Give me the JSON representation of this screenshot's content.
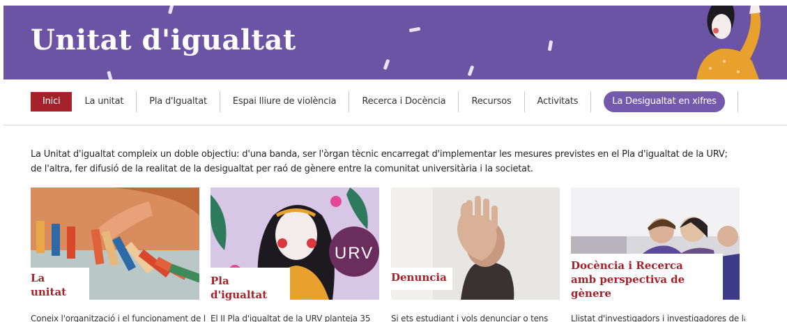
{
  "banner": {
    "title": "Unitat d'igualtat"
  },
  "nav": {
    "items": [
      {
        "label": "Inici",
        "active": true
      },
      {
        "label": "La unitat"
      },
      {
        "label": "Pla d'Igualtat"
      },
      {
        "label": "Espai lliure de violència"
      },
      {
        "label": "Recerca i Docència"
      },
      {
        "label": "Recursos"
      },
      {
        "label": "Activitats"
      }
    ],
    "highlight": "La Desigualtat en xifres"
  },
  "intro": "La Unitat d'igualtat compleix un doble objectiu: d'una banda, ser l'òrgan tècnic encarregat d'implementar les mesures previstes en el Pla d'igualtat de la URV; de l'altra, fer difusió de la realitat de la desigualtat per raó de gènere entre la comunitat universitària i la societat.",
  "cards": [
    {
      "title": "La unitat",
      "desc": "Coneix l'organització i el funcionament de la"
    },
    {
      "title": "Pla d'igualtat",
      "desc": "El II Pla d'igualtat de la URV planteja 35"
    },
    {
      "title": "Denuncia",
      "desc": "Si ets estudiant i vols denunciar o tens"
    },
    {
      "title": "Docència i Recerca amb perspectiva de gènere",
      "desc": "Llistat d'investigadors i investigadores de la"
    }
  ],
  "badge": {
    "text": "URV"
  },
  "colors": {
    "banner": "#6a54a3",
    "accent": "#a5222b",
    "pill": "#7559ad"
  }
}
